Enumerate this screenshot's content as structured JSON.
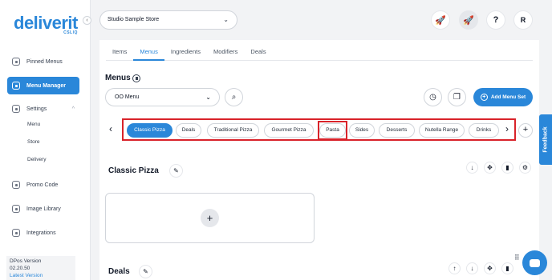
{
  "logo": {
    "main": "deliverit",
    "sub": "CSLIQ"
  },
  "sidebar": {
    "items": [
      {
        "label": "Pinned Menus"
      },
      {
        "label": "Menu Manager"
      },
      {
        "label": "Settings"
      },
      {
        "label": "Promo Code"
      },
      {
        "label": "Image Library"
      },
      {
        "label": "Integrations"
      }
    ],
    "settings_sub": [
      "Menu",
      "Store",
      "Delivery"
    ],
    "version_label": "DPos Version",
    "version_number": "02.20.50",
    "version_link": "Latest Version"
  },
  "topbar": {
    "store": "Studio Sample Store",
    "avatar": "R"
  },
  "tabs": [
    "Items",
    "Menus",
    "Ingredients",
    "Modifiers",
    "Deals"
  ],
  "menus": {
    "title": "Menus",
    "selected_menu": "OO Menu",
    "add_button": "Add Menu Set"
  },
  "categories": [
    "Classic Pizza",
    "Deals",
    "Traditional Pizza",
    "Gourmet Pizza",
    "Pasta",
    "Sides",
    "Desserts",
    "Nutella Range",
    "Drinks"
  ],
  "sections": [
    {
      "title": "Classic Pizza"
    },
    {
      "title": "Deals"
    }
  ],
  "feedback": "Feedback",
  "colors": {
    "accent": "#2a87d9",
    "highlight": "#d9232a"
  }
}
